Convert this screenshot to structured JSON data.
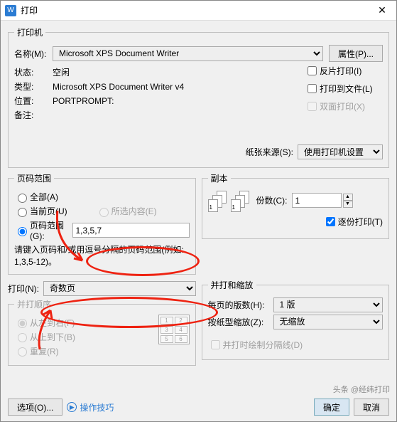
{
  "titlebar": {
    "icon": "W",
    "title": "打印"
  },
  "printer": {
    "legend": "打印机",
    "name_label": "名称(M):",
    "name_value": "Microsoft XPS Document Writer",
    "props_btn": "属性(P)...",
    "status_label": "状态:",
    "status_value": "空闲",
    "type_label": "类型:",
    "type_value": "Microsoft XPS Document Writer v4",
    "where_label": "位置:",
    "where_value": "PORTPROMPT:",
    "comment_label": "备注:",
    "chk_reverse": "反片打印(I)",
    "chk_tofile": "打印到文件(L)",
    "chk_duplex": "双面打印(X)",
    "source_label": "纸张来源(S):",
    "source_value": "使用打印机设置"
  },
  "range": {
    "legend": "页码范围",
    "all": "全部(A)",
    "current": "当前页(U)",
    "selection": "所选内容(E)",
    "pages": "页码范围(G):",
    "pages_value": "1,3,5,7",
    "hint": "请键入页码和/或用逗号分隔的页码范围(例如: 1,3,5-12)。",
    "print_label": "打印(N):",
    "print_value": "奇数页",
    "merge_legend": "并打顺序",
    "lr": "从左到右(F)",
    "tb": "从上到下(B)",
    "rep": "重复(R)"
  },
  "copies": {
    "legend": "副本",
    "count_label": "份数(C):",
    "count_value": "1",
    "collate": "逐份打印(T)"
  },
  "zoom": {
    "legend": "并打和缩放",
    "pps_label": "每页的版数(H):",
    "pps_value": "1 版",
    "scale_label": "按纸型缩放(Z):",
    "scale_value": "无缩放",
    "chk_lines": "并打时绘制分隔线(D)"
  },
  "footer": {
    "options": "选项(O)...",
    "tips": "操作技巧",
    "ok": "确定",
    "cancel": "取消"
  },
  "watermark": "头条 @经纬打印"
}
